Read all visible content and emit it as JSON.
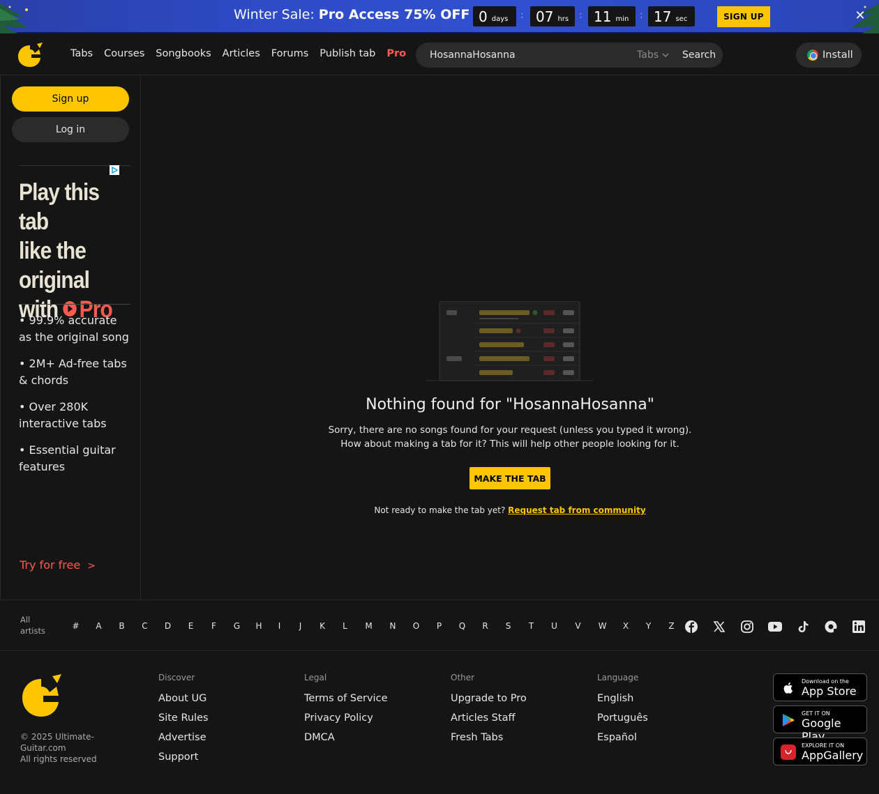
{
  "promo": {
    "prefix": "Winter Sale: ",
    "highlight": "Pro Access 75% OFF",
    "timer": [
      {
        "value": "0",
        "unit": "days"
      },
      {
        "value": "07",
        "unit": "hrs"
      },
      {
        "value": "11",
        "unit": "min"
      },
      {
        "value": "17",
        "unit": "sec"
      }
    ],
    "signup_label": "SIGN UP",
    "close_glyph": "✕"
  },
  "nav": {
    "items": [
      "Tabs",
      "Courses",
      "Songbooks",
      "Articles",
      "Forums",
      "Publish tab"
    ],
    "pro": "Pro"
  },
  "search": {
    "value": "HosannaHosanna",
    "type": "Tabs",
    "button": "Search"
  },
  "install": {
    "label": "Install"
  },
  "sidebar": {
    "signup": "Sign up",
    "login": "Log in",
    "ad": {
      "headline_line1": "Play this tab",
      "headline_line2": "like the",
      "headline_line3": "original",
      "headline_line4": "with",
      "headline_pro": "Pro",
      "bullets": [
        "• 99.9% accurate as the original song",
        "• 2M+ Ad-free tabs & chords",
        "• Over 280K interactive tabs",
        "• Essential guitar features"
      ],
      "cta": "Try for free"
    }
  },
  "main": {
    "title": "Nothing found for \"HosannaHosanna\"",
    "line1": "Sorry, there are no songs found for your request (unless you typed it wrong).",
    "line2": "How about making a tab for it? This will help other people looking for it.",
    "make_tab": "MAKE THE TAB",
    "request_prefix": "Not ready to make the tab yet? ",
    "request_link": "Request tab from community"
  },
  "alphabet": {
    "all_line1": "All",
    "all_line2": "artists",
    "letters": [
      "#",
      "A",
      "B",
      "C",
      "D",
      "E",
      "F",
      "G",
      "H",
      "I",
      "J",
      "K",
      "L",
      "M",
      "N",
      "O",
      "P",
      "Q",
      "R",
      "S",
      "T",
      "U",
      "V",
      "W",
      "X",
      "Y",
      "Z"
    ],
    "socials": [
      "facebook-icon",
      "x-icon",
      "instagram-icon",
      "youtube-icon",
      "tiktok-icon",
      "threads-icon",
      "linkedin-icon"
    ]
  },
  "footer": {
    "copyright_line1": "© 2025 Ultimate-Guitar.com",
    "copyright_line2": "All rights reserved",
    "discover": {
      "heading": "Discover",
      "links": [
        "About UG",
        "Site Rules",
        "Advertise",
        "Support"
      ]
    },
    "legal": {
      "heading": "Legal",
      "links": [
        "Terms of Service",
        "Privacy Policy",
        "DMCA"
      ]
    },
    "other": {
      "heading": "Other",
      "links": [
        "Upgrade to Pro",
        "Articles Staff",
        "Fresh Tabs"
      ]
    },
    "language": {
      "heading": "Language",
      "links": [
        "English",
        "Português",
        "Español"
      ]
    },
    "stores": [
      {
        "small": "Download on the",
        "big": "App Store"
      },
      {
        "small": "GET IT ON",
        "big": "Google Play"
      },
      {
        "small": "EXPLORE IT ON",
        "big": "AppGallery"
      }
    ]
  },
  "colors": {
    "accent": "#ffc600",
    "pro": "#ff5a4f",
    "background": "#151515"
  }
}
